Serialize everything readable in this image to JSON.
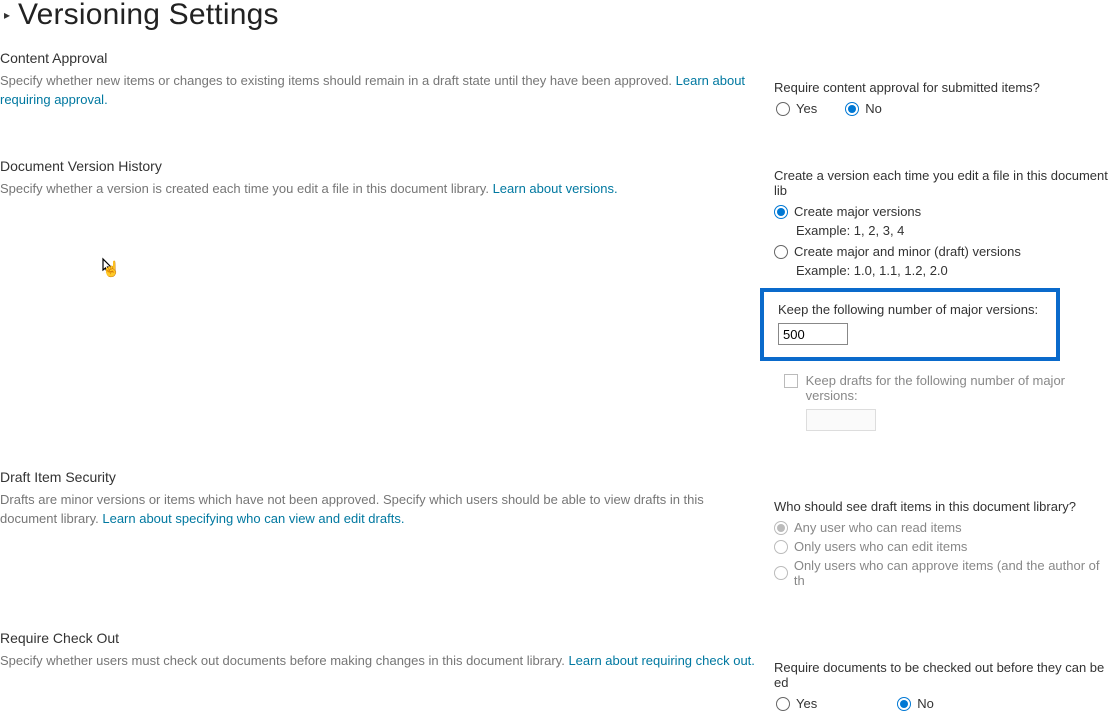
{
  "page": {
    "title": "Versioning Settings"
  },
  "sections": {
    "approval": {
      "heading": "Content Approval",
      "desc": "Specify whether new items or changes to existing items should remain in a draft state until they have been approved.  ",
      "link": "Learn about requiring approval.",
      "question": "Require content approval for submitted items?",
      "yes": "Yes",
      "no": "No"
    },
    "version": {
      "heading": "Document Version History",
      "desc": "Specify whether a version is created each time you edit a file in this document library.  ",
      "link": "Learn about versions.",
      "question": "Create a version each time you edit a file in this document lib",
      "opt_major": "Create major versions",
      "ex_major": "Example: 1, 2, 3, 4",
      "opt_minor": "Create major and minor (draft) versions",
      "ex_minor": "Example: 1.0, 1.1, 1.2, 2.0",
      "keep_label": "Keep the following number of major versions:",
      "keep_value": "500",
      "keep_drafts_label": "Keep drafts for the following number of major versions:"
    },
    "draft": {
      "heading": "Draft Item Security",
      "desc": "Drafts are minor versions or items which have not been approved. Specify which users should be able to view drafts in this document library.  ",
      "link": "Learn about specifying who can view and edit drafts.",
      "question": "Who should see draft items in this document library?",
      "opt1": "Any user who can read items",
      "opt2": "Only users who can edit items",
      "opt3": "Only users who can approve items (and the author of th"
    },
    "checkout": {
      "heading": "Require Check Out",
      "desc": "Specify whether users must check out documents before making changes in this document library.  ",
      "link": "Learn about requiring check out.",
      "question": "Require documents to be checked out before they can be ed",
      "yes": "Yes",
      "no": "No"
    }
  }
}
